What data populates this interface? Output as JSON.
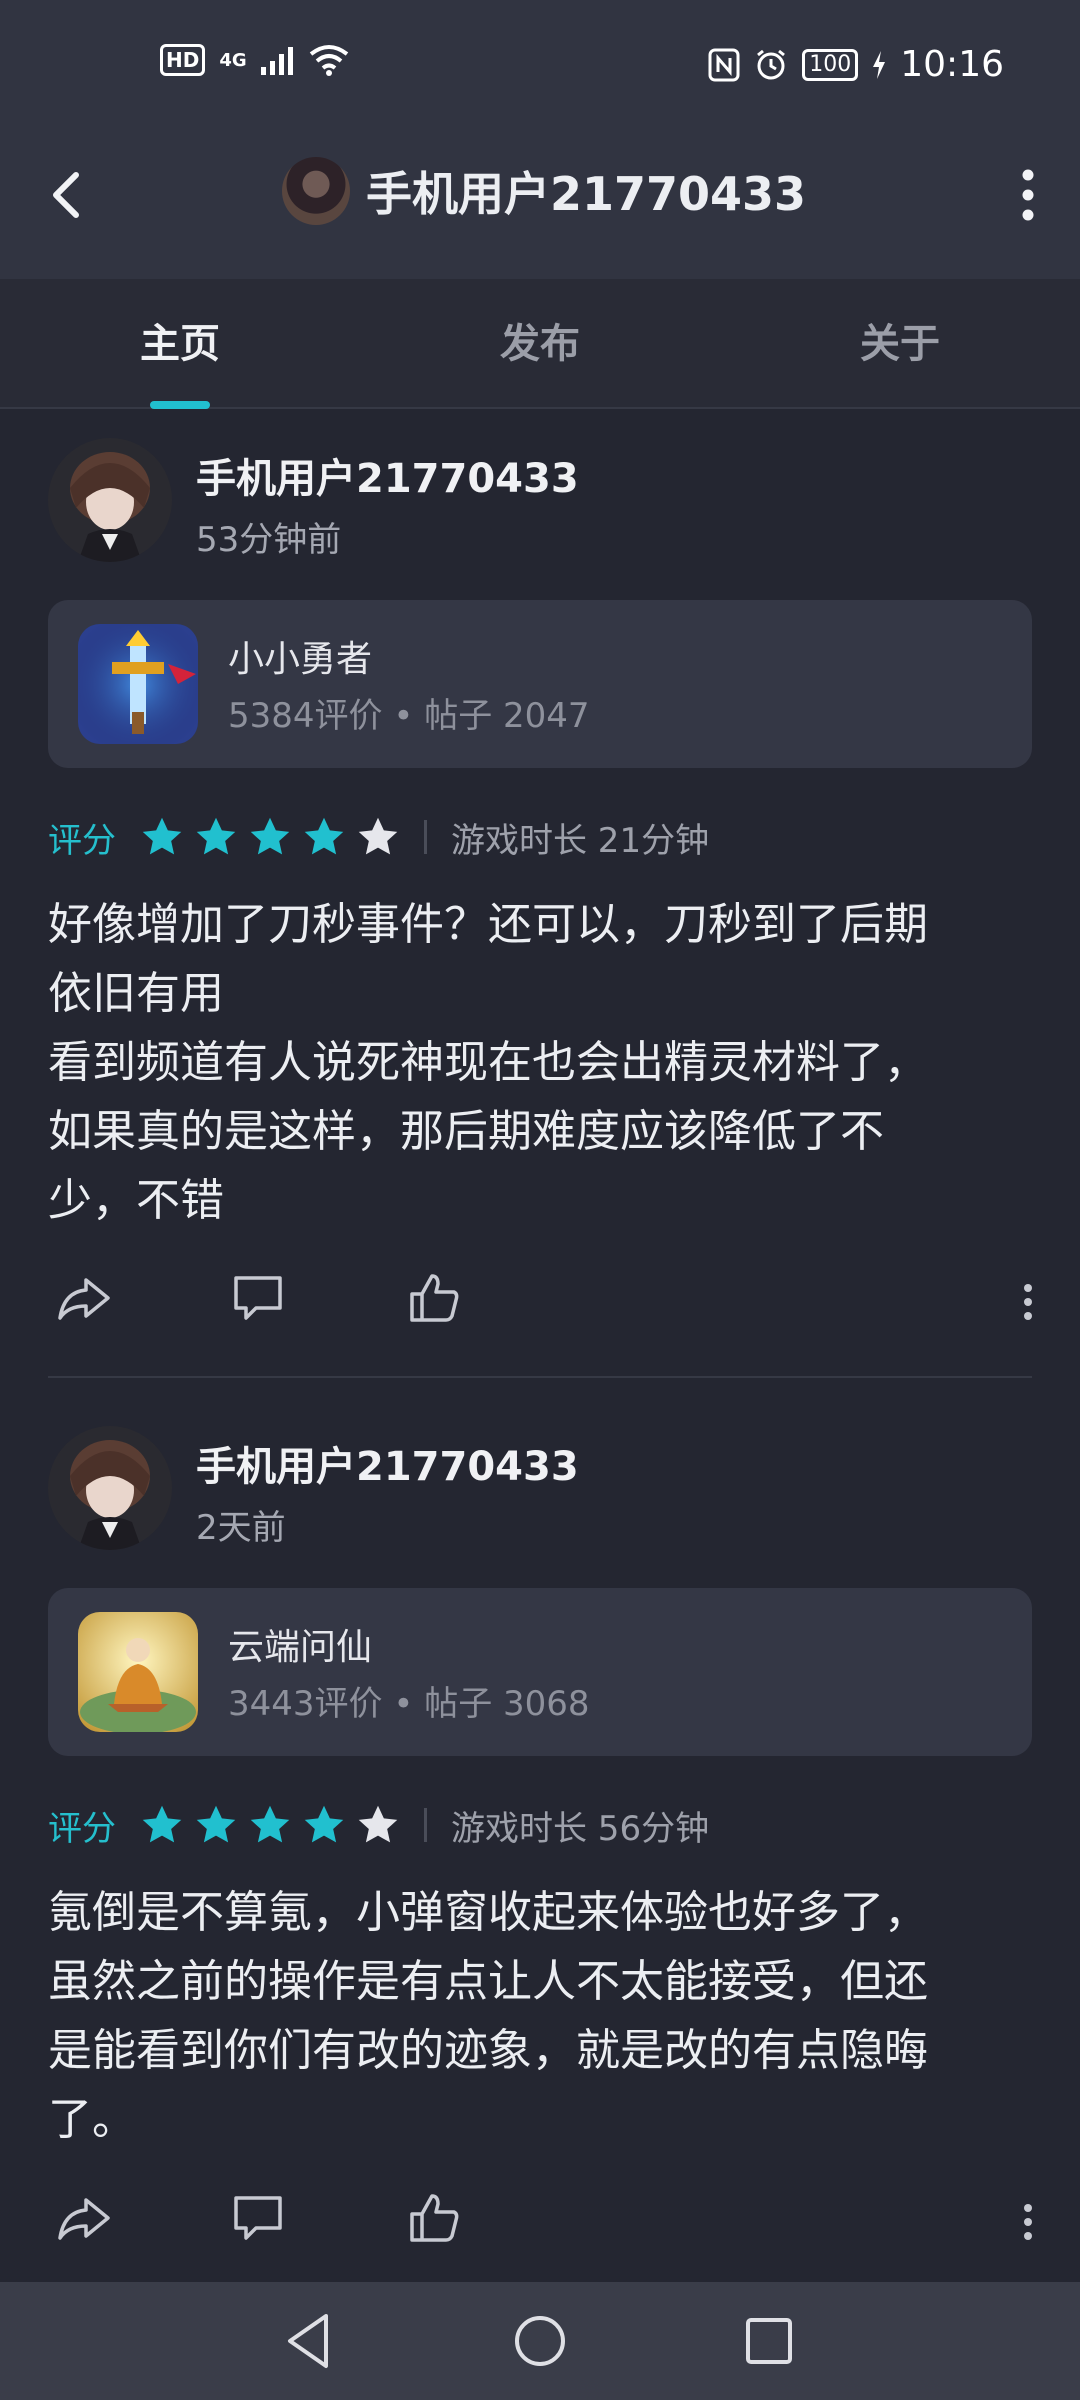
{
  "status_bar": {
    "hd": "HD",
    "network": "4G",
    "battery": "100",
    "time": "10:16"
  },
  "header": {
    "title": "手机用户21770433"
  },
  "tabs": [
    {
      "label": "主页",
      "active": true
    },
    {
      "label": "发布",
      "active": false
    },
    {
      "label": "关于",
      "active": false
    }
  ],
  "posts": [
    {
      "username": "手机用户21770433",
      "time": "53分钟前",
      "game": {
        "name": "小小勇者",
        "stats": "5384评价 • 帖子 2047",
        "icon": "sword-game-icon"
      },
      "rating_label": "评分",
      "stars": 4,
      "stars_total": 5,
      "playtime": "游戏时长 21分钟",
      "text": "好像增加了刀秒事件？还可以，刀秒到了后期\n依旧有用\n看到频道有人说死神现在也会出精灵材料了，\n如果真的是这样，那后期难度应该降低了不\n少，不错"
    },
    {
      "username": "手机用户21770433",
      "time": "2天前",
      "game": {
        "name": "云端问仙",
        "stats": "3443评价 • 帖子 3068",
        "icon": "immortal-game-icon"
      },
      "rating_label": "评分",
      "stars": 4,
      "stars_total": 5,
      "playtime": "游戏时长 56分钟",
      "text": "氪倒是不算氪，小弹窗收起来体验也好多了，\n虽然之前的操作是有点让人不太能接受，但还\n是能看到你们有改的迹象，就是改的有点隐晦\n了。"
    }
  ],
  "colors": {
    "accent": "#21c0cf",
    "background": "#242631",
    "card": "#343745"
  }
}
